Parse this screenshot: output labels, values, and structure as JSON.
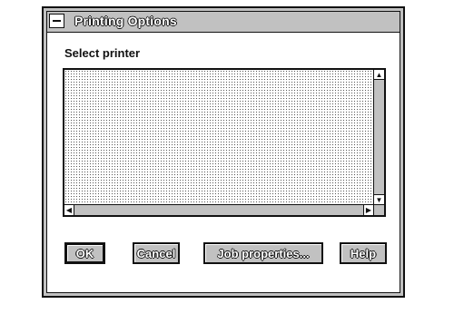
{
  "window": {
    "title": "Printing Options",
    "system_menu_icon": "minus-icon"
  },
  "main": {
    "select_label": "Select printer",
    "printer_list": []
  },
  "scrollbars": {
    "up_icon": "arrow-up-icon",
    "down_icon": "arrow-down-icon",
    "left_icon": "arrow-left-icon",
    "right_icon": "arrow-right-icon"
  },
  "buttons": {
    "ok": "OK",
    "cancel": "Cancel",
    "job_properties": "Job properties...",
    "help": "Help"
  }
}
